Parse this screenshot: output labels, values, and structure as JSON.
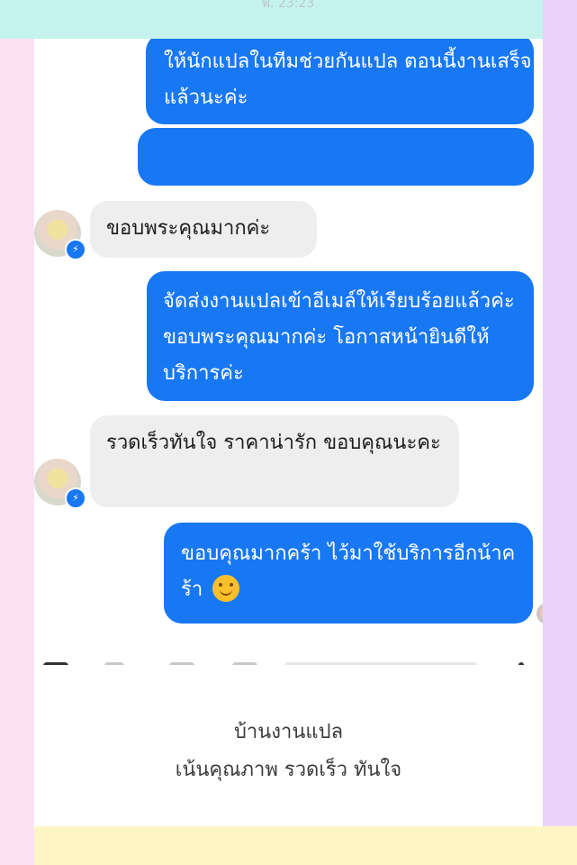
{
  "status_bar": {
    "time": "พ. 23:23"
  },
  "messages": [
    {
      "from": "me",
      "text": "ให้นักแปลในทีมช่วยกันแปล ตอนนี้งานเสร็จแล้วนะค่ะ"
    },
    {
      "from": "me",
      "text": ""
    },
    {
      "from": "customer",
      "text": "ขอบพระคุณมากค่ะ"
    },
    {
      "from": "me",
      "text": "จัดส่งงานแปลเข้าอีเมล์ให้เรียบร้อยแล้วค่ะ ขอบพระคุณมากค่ะ โอกาสหน้ายินดีให้บริการค่ะ"
    },
    {
      "from": "customer",
      "text": "รวดเร็วทันใจ ราคาน่ารัก ขอบคุณนะคะ"
    },
    {
      "from": "me",
      "text": "ขอบคุณมากคร้า ไว้มาใช้บริการอีกน้าคร้า",
      "emoji": "smiling-face-emoji"
    }
  ],
  "icons": {
    "messenger_badge": "messenger-icon",
    "seen": "seen-avatar"
  },
  "caption": {
    "line1": "บ้านงานแปล",
    "line2": "เน้นคุณภาพ รวดเร็ว ทันใจ"
  },
  "colors": {
    "outgoing_bubble": "#1877f2",
    "incoming_bubble": "#eeeeee",
    "frame_top": "#c4f3ee",
    "frame_left": "#fbe1f1",
    "frame_right": "#e9d3fb",
    "frame_bottom": "#fdf6c4"
  }
}
